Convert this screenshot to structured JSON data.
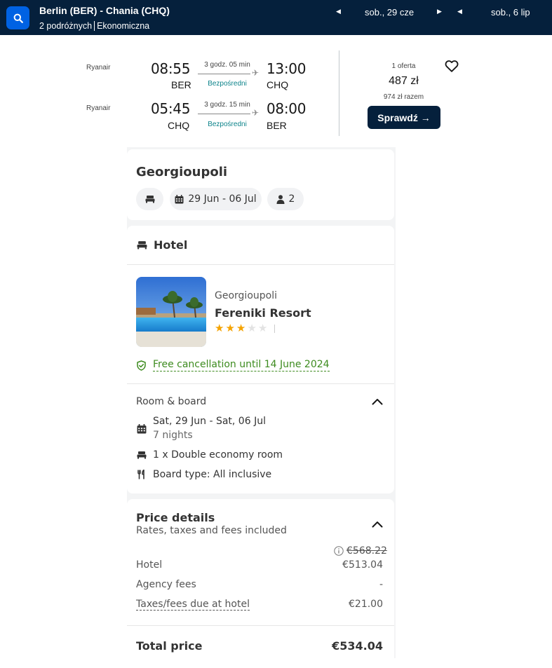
{
  "search": {
    "route": "Berlin (BER) - Chania (CHQ)",
    "travellers": "2 podróżnych",
    "cabin": "Ekonomiczna",
    "depart_date": "sob., 29 cze",
    "return_date": "sob., 6 lip",
    "icon": "search-icon"
  },
  "flight": {
    "outbound": {
      "airline": "Ryanair",
      "dep_time": "08:55",
      "dep_code": "BER",
      "duration": "3 godz. 05 min",
      "stops": "Bezpośredni",
      "arr_time": "13:00",
      "arr_code": "CHQ"
    },
    "inbound": {
      "airline": "Ryanair",
      "dep_time": "05:45",
      "dep_code": "CHQ",
      "duration": "3 godz. 15 min",
      "stops": "Bezpośredni",
      "arr_time": "08:00",
      "arr_code": "BER"
    },
    "offers": "1 oferta",
    "price": "487 zł",
    "total": "974 zł razem",
    "cta": "Sprawdź →"
  },
  "summary": {
    "destination": "Georgioupoli",
    "dates": "29 Jun - 06 Jul",
    "guests": "2"
  },
  "hotel": {
    "section_title": "Hotel",
    "location": "Georgioupoli",
    "name": "Fereniki Resort",
    "rating": 3,
    "max_rating": 5,
    "cancellation": "Free cancellation until 14 June 2024",
    "colors": {
      "star": "#f5a300",
      "star_empty": "#e3e3e3",
      "cancel_green": "#3d8b1f"
    }
  },
  "room": {
    "title": "Room & board",
    "dates": "Sat, 29 Jun - Sat, 06 Jul",
    "nights": "7 nights",
    "room_type": "1 x Double economy room",
    "board": "Board type: All inclusive"
  },
  "price": {
    "title": "Price details",
    "subtitle": "Rates, taxes and fees included",
    "original": "€568.22",
    "rows": [
      {
        "label": "Hotel",
        "value": "€513.04"
      },
      {
        "label": "Agency fees",
        "value": "-"
      },
      {
        "label": "Taxes/fees due at hotel",
        "value": "€21.00"
      }
    ],
    "total_label": "Total price",
    "total_value": "€534.04"
  }
}
